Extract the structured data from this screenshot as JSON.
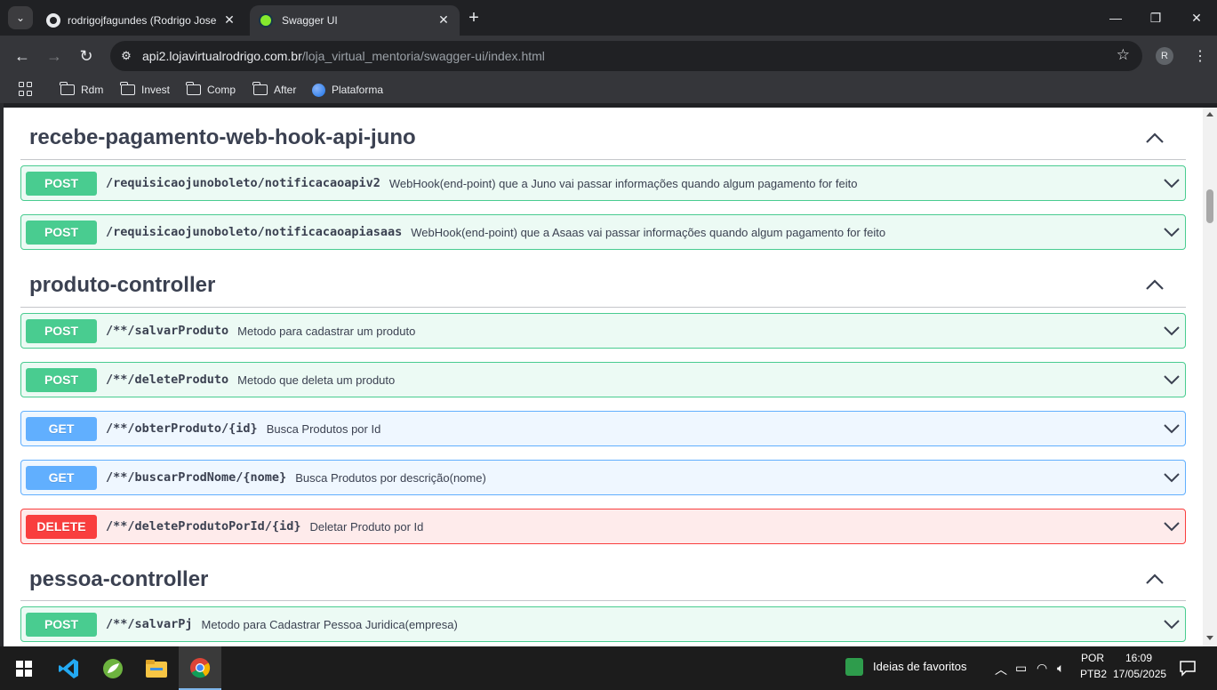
{
  "browser": {
    "tabs": [
      {
        "title": "rodrigojfagundes (Rodrigo Jose",
        "active": false,
        "icon": "github-icon"
      },
      {
        "title": "Swagger UI",
        "active": true,
        "icon": "swagger-icon"
      }
    ],
    "url_host": "api2.lojavirtualrodrigo.com.br",
    "url_path": "/loja_virtual_mentoria/swagger-ui/index.html",
    "profile_initial": "R",
    "bookmarks": [
      {
        "label": "Rdm",
        "icon": "folder-icon"
      },
      {
        "label": "Invest",
        "icon": "folder-icon"
      },
      {
        "label": "Comp",
        "icon": "folder-icon"
      },
      {
        "label": "After",
        "icon": "folder-icon"
      },
      {
        "label": "Plataforma",
        "icon": "globe-icon"
      }
    ]
  },
  "sections": [
    {
      "title": "recebe-pagamento-web-hook-api-juno",
      "operations": [
        {
          "method": "POST",
          "path": "/requisicaojunoboleto/notificacaoapiv2",
          "summary": "WebHook(end-point) que a Juno vai passar informações quando algum pagamento for feito"
        },
        {
          "method": "POST",
          "path": "/requisicaojunoboleto/notificacaoapiasaas",
          "summary": "WebHook(end-point) que a Asaas vai passar informações quando algum pagamento for feito"
        }
      ]
    },
    {
      "title": "produto-controller",
      "operations": [
        {
          "method": "POST",
          "path": "/**/salvarProduto",
          "summary": "Metodo para cadastrar um produto"
        },
        {
          "method": "POST",
          "path": "/**/deleteProduto",
          "summary": "Metodo que deleta um produto"
        },
        {
          "method": "GET",
          "path": "/**/obterProduto/{id}",
          "summary": "Busca Produtos por Id"
        },
        {
          "method": "GET",
          "path": "/**/buscarProdNome/{nome}",
          "summary": "Busca Produtos por descrição(nome)"
        },
        {
          "method": "DELETE",
          "path": "/**/deleteProdutoPorId/{id}",
          "summary": "Deletar Produto por Id"
        }
      ]
    },
    {
      "title": "pessoa-controller",
      "operations": [
        {
          "method": "POST",
          "path": "/**/salvarPj",
          "summary": "Metodo para Cadastrar Pessoa Juridica(empresa)"
        }
      ]
    }
  ],
  "taskbar": {
    "widget_label": "Ideias de favoritos",
    "lang_top": "POR",
    "lang_bottom": "PTB2",
    "time": "16:09",
    "date": "17/05/2025"
  },
  "colors": {
    "post": "#49cc90",
    "get": "#61affe",
    "delete": "#f93e3e",
    "title": "#3b4151"
  }
}
